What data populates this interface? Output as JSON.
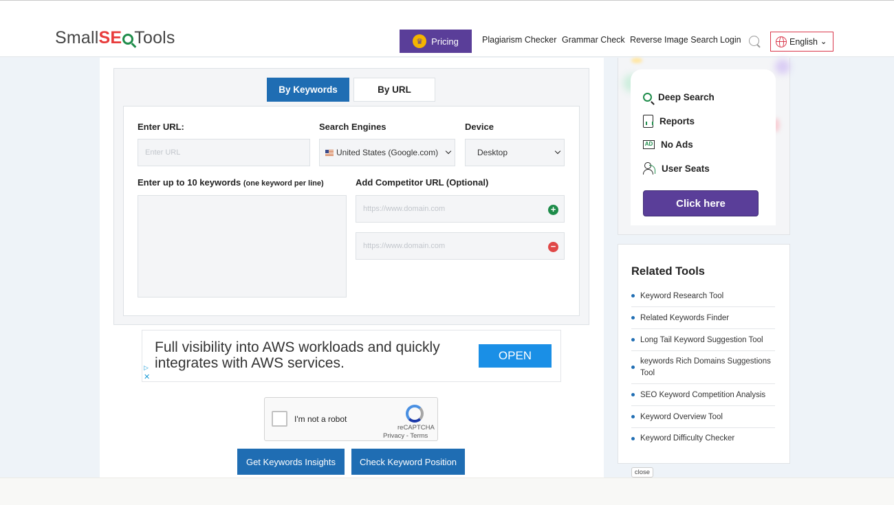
{
  "header": {
    "logo": {
      "part1": "Small",
      "part2": "SE",
      "part3": "Tools"
    },
    "pricing_label": "Pricing",
    "nav": [
      "Plagiarism Checker",
      "Grammar Check",
      "Reverse Image Search",
      "Login"
    ],
    "language": "English"
  },
  "tabs": {
    "active": "By Keywords",
    "inactive": "By URL"
  },
  "form": {
    "url_label": "Enter URL:",
    "url_placeholder": "Enter URL",
    "engines_label": "Search Engines",
    "engine_value": "United States (Google.com)",
    "device_label": "Device",
    "device_value": "Desktop",
    "keywords_label": "Enter up to 10 keywords",
    "keywords_hint": "(one keyword per line)",
    "competitor_label": "Add Competitor URL (Optional)",
    "competitor_placeholder_1": "https://www.domain.com",
    "competitor_placeholder_2": "https://www.domain.com",
    "add_symbol": "+",
    "remove_symbol": "−"
  },
  "ad": {
    "text": "Full visibility into AWS workloads and quickly integrates with AWS services.",
    "cta": "OPEN",
    "adchoices": "▷",
    "close": "✕"
  },
  "captcha": {
    "label": "I'm not a robot",
    "brand": "reCAPTCHA",
    "links": "Privacy - Terms"
  },
  "actions": {
    "insights": "Get Keywords Insights",
    "position": "Check Keyword Position"
  },
  "promo": {
    "features": [
      "Deep Search",
      "Reports",
      "No Ads",
      "User Seats"
    ],
    "ad_icon_text": "AD",
    "cta": "Click here"
  },
  "related": {
    "title": "Related Tools",
    "items": [
      "Keyword Research Tool",
      "Related Keywords Finder",
      "Long Tail Keyword Suggestion Tool",
      "keywords Rich Domains Suggestions Tool",
      "SEO Keyword Competition Analysis",
      "Keyword Overview Tool",
      "Keyword Difficulty Checker"
    ],
    "close": "close"
  },
  "colors": {
    "primary": "#1f6db3",
    "purple": "#5a3e99",
    "green": "#1e8c4a",
    "red": "#e04848"
  }
}
